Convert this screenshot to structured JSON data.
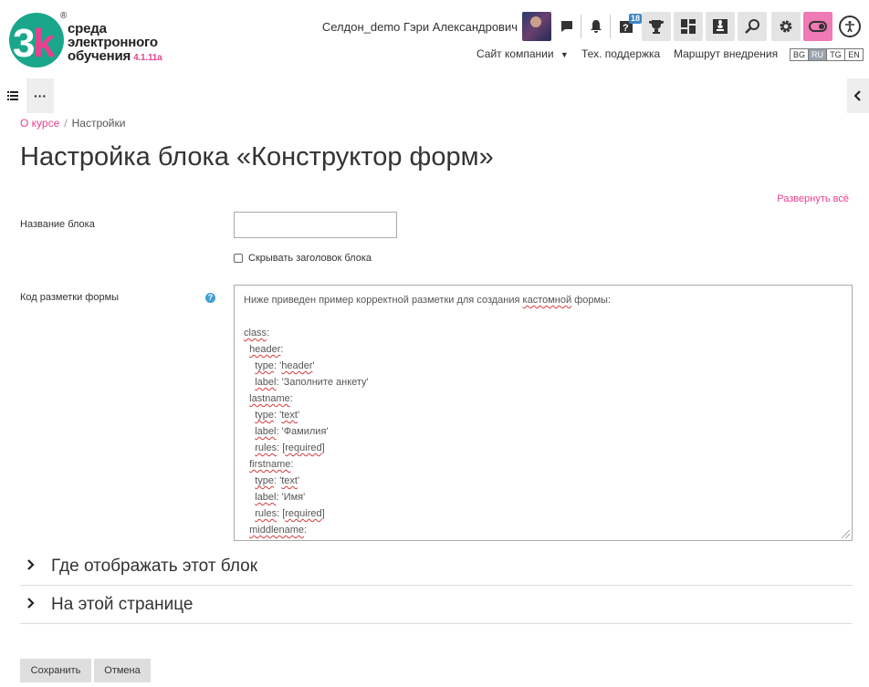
{
  "brand": {
    "line1": "среда",
    "line2": "электронного",
    "line3": "обучения",
    "version": "4.1.11a",
    "reg": "®",
    "accent_color": "#e8418f",
    "logo_color_green": "#1aa68a"
  },
  "header": {
    "user_name": "Селдон_demo Гэри Александрович",
    "messages_badge": "18",
    "nav": {
      "company_site": "Сайт компании",
      "support": "Тех. поддержка",
      "roadmap": "Маршрут внедрения"
    },
    "languages": [
      "BG",
      "RU",
      "TG",
      "EN"
    ],
    "active_language": "RU",
    "icons": [
      "chat-icon",
      "bell-icon",
      "quiz-icon",
      "trophy-icon",
      "dashboard-icon",
      "chess-icon",
      "search-icon",
      "gear-icon",
      "toggle-icon",
      "accessibility-icon"
    ]
  },
  "secondary": {
    "more_label": "···"
  },
  "breadcrumb": {
    "items": [
      "О курсе",
      "Настройки"
    ],
    "separator": "/"
  },
  "page": {
    "title": "Настройка блока «Конструктор форм»",
    "expand_all": "Развернуть всё"
  },
  "form": {
    "block_name_label": "Название блока",
    "block_name_value": "",
    "hide_header_label": "Скрывать заголовок блока",
    "markup_label": "Код разметки формы",
    "markup_intro": "Ниже приведен пример корректной разметки для создания ",
    "markup_intro_word": "кастомной",
    "markup_intro_end": " формы:",
    "markup_lines": [
      {
        "indent": "",
        "key": "class",
        "rest": ":"
      },
      {
        "indent": "  ",
        "key": "header",
        "rest": ":"
      },
      {
        "indent": "    ",
        "key": "type",
        "rest": ": '",
        "val": "header",
        "end": "'"
      },
      {
        "indent": "    ",
        "key": "label",
        "rest": ": 'Заполните анкету'"
      },
      {
        "indent": "  ",
        "key": "lastname",
        "rest": ":"
      },
      {
        "indent": "    ",
        "key": "type",
        "rest": ": '",
        "val": "text",
        "end": "'"
      },
      {
        "indent": "    ",
        "key": "label",
        "rest": ": 'Фамилия'"
      },
      {
        "indent": "    ",
        "key": "rules",
        "rest": ": [",
        "val": "required",
        "end": "]"
      },
      {
        "indent": "  ",
        "key": "firstname",
        "rest": ":"
      },
      {
        "indent": "    ",
        "key": "type",
        "rest": ": '",
        "val": "text",
        "end": "'"
      },
      {
        "indent": "    ",
        "key": "label",
        "rest": ": 'Имя'"
      },
      {
        "indent": "    ",
        "key": "rules",
        "rest": ": [",
        "val": "required",
        "end": "]"
      },
      {
        "indent": "  ",
        "key": "middlename",
        "rest": ":"
      }
    ]
  },
  "sections": [
    {
      "title": "Где отображать этот блок"
    },
    {
      "title": "На этой странице"
    }
  ],
  "buttons": {
    "save": "Сохранить",
    "cancel": "Отмена"
  }
}
